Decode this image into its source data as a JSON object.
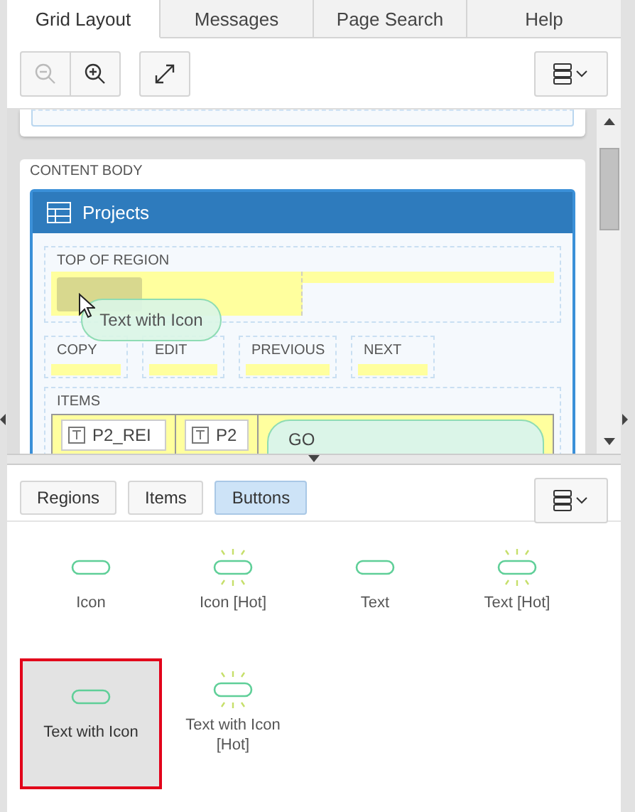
{
  "tabs": [
    {
      "label": "Grid Layout",
      "selected": true
    },
    {
      "label": "Messages",
      "selected": false
    },
    {
      "label": "Page Search",
      "selected": false
    },
    {
      "label": "Help",
      "selected": false
    }
  ],
  "toolbar": [
    {
      "kind": "zoom-out",
      "disabled": true
    },
    {
      "kind": "zoom-in",
      "disabled": false
    },
    {
      "kind": "expand",
      "disabled": false
    },
    {
      "kind": "menu",
      "disabled": false
    }
  ],
  "layout": {
    "section_label": "CONTENT BODY",
    "region_title": "Projects",
    "top_label": "TOP OF REGION",
    "buttons": [
      "COPY",
      "EDIT",
      "PREVIOUS",
      "NEXT"
    ],
    "items_label": "ITEMS",
    "fields": [
      "P2_REI",
      "P2"
    ],
    "go_button": "GO",
    "dragged_button": "Text with Icon"
  },
  "gallery": {
    "filters": [
      {
        "label": "Regions",
        "selected": false
      },
      {
        "label": "Items",
        "selected": false
      },
      {
        "label": "Buttons",
        "selected": true
      }
    ],
    "items": [
      {
        "label": "Icon",
        "kind": "plain",
        "selected": false
      },
      {
        "label": "Icon [Hot]",
        "kind": "hot",
        "selected": false
      },
      {
        "label": "Text",
        "kind": "plain",
        "selected": false
      },
      {
        "label": "Text [Hot]",
        "kind": "hot",
        "selected": false
      },
      {
        "label": "Text with Icon",
        "kind": "plain",
        "selected": true
      },
      {
        "label": "Text with Icon [Hot]",
        "kind": "hot",
        "selected": false
      }
    ]
  }
}
